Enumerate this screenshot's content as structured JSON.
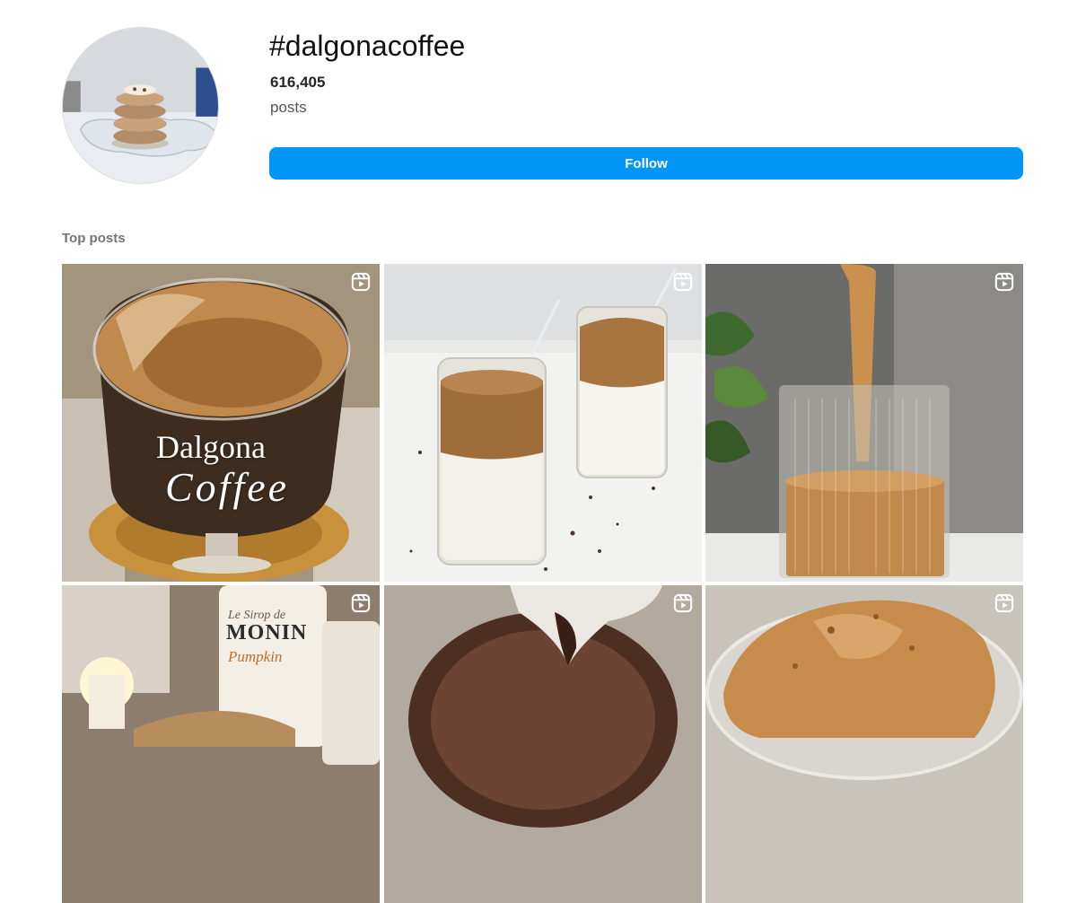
{
  "header": {
    "hashtag": "#dalgonacoffee",
    "post_count": "616,405",
    "post_count_label": "posts",
    "follow_label": "Follow"
  },
  "top_posts": {
    "title": "Top posts",
    "posts": [
      {
        "id": "post-1",
        "icon": "reel-icon",
        "overlay_line1": "Dalgona",
        "overlay_line2": "Coffee"
      },
      {
        "id": "post-2",
        "icon": "reel-icon"
      },
      {
        "id": "post-3",
        "icon": "reel-icon"
      },
      {
        "id": "post-4",
        "icon": "reel-icon",
        "label_line1": "Le Sirop de",
        "label_line2": "MONIN",
        "label_line3": "Pumpkin"
      },
      {
        "id": "post-5",
        "icon": "reel-icon"
      },
      {
        "id": "post-6",
        "icon": "reel-icon"
      }
    ]
  },
  "colors": {
    "accent": "#0095f6",
    "text": "#262626",
    "muted": "#737373"
  }
}
